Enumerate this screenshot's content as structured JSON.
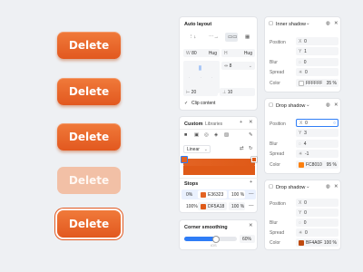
{
  "buttons": {
    "label": "Delete"
  },
  "auto_layout": {
    "title": "Auto layout",
    "w_label": "W",
    "w_value": "80",
    "w_mode": "Hug",
    "h_label": "H",
    "h_mode": "Hug",
    "gap": "8",
    "padding_h": "20",
    "padding_v": "10",
    "clip_label": "Clip content"
  },
  "inner_shadow": {
    "title": "Inner shadow",
    "position_label": "Position",
    "x_label": "X",
    "x": "0",
    "y_label": "Y",
    "y": "1",
    "blur_label": "Blur",
    "blur": "0",
    "spread_label": "Spread",
    "spread": "0",
    "color_label": "Color",
    "color": "FFFFFF",
    "opacity": "35 %",
    "swatch": "#ffffff"
  },
  "drop_shadow_1": {
    "title": "Drop shadow",
    "position_label": "Position",
    "x_label": "X",
    "x": "0",
    "y_label": "Y",
    "y": "3",
    "blur_label": "Blur",
    "blur": "4",
    "spread_label": "Spread",
    "spread": "-1",
    "color_label": "Color",
    "color": "FC8010",
    "opacity": "95 %",
    "swatch": "#fc8010"
  },
  "drop_shadow_2": {
    "title": "Drop shadow",
    "position_label": "Position",
    "x_label": "X",
    "x": "0",
    "y_label": "Y",
    "y": "0",
    "blur_label": "Blur",
    "blur": "0",
    "spread_label": "Spread",
    "spread": "0",
    "color_label": "Color",
    "color": "BF4A0F",
    "opacity": "100 %",
    "swatch": "#bf4a0f"
  },
  "fill": {
    "tab_custom": "Custom",
    "tab_libraries": "Libraries",
    "gradient_type": "Linear",
    "stops_label": "Stops",
    "stops": [
      {
        "pos": "0%",
        "color": "E36323",
        "opacity": "100 %",
        "swatch": "#e36323"
      },
      {
        "pos": "100%",
        "color": "DF5A18",
        "opacity": "100 %",
        "swatch": "#df5a18"
      }
    ]
  },
  "corner": {
    "title": "Corner smoothing",
    "value": "60%",
    "fraction": 0.6,
    "tick": "iOS"
  },
  "colors": {
    "accent": "#2f7df6",
    "orange": "#e2581f"
  }
}
